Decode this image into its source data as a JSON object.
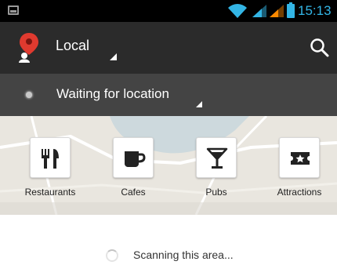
{
  "status_bar": {
    "time": "15:13",
    "icons": [
      "gallery-icon",
      "wifi-icon",
      "signal-icon",
      "battery-icon"
    ],
    "accent_color": "#33b5e5"
  },
  "action_bar": {
    "title": "Local",
    "icons": [
      "map-pin-icon",
      "search-icon"
    ],
    "background": "#2b2b2b"
  },
  "location_bar": {
    "text": "Waiting for location",
    "background": "#444444"
  },
  "categories": [
    {
      "label": "Restaurants",
      "icon": "fork-knife-icon"
    },
    {
      "label": "Cafes",
      "icon": "coffee-cup-icon"
    },
    {
      "label": "Pubs",
      "icon": "cocktail-glass-icon"
    },
    {
      "label": "Attractions",
      "icon": "ticket-star-icon"
    }
  ],
  "content": {
    "scan_text": "Scanning this area..."
  },
  "colors": {
    "pin_red": "#e03a2f",
    "map_background": "#e9e6df"
  }
}
